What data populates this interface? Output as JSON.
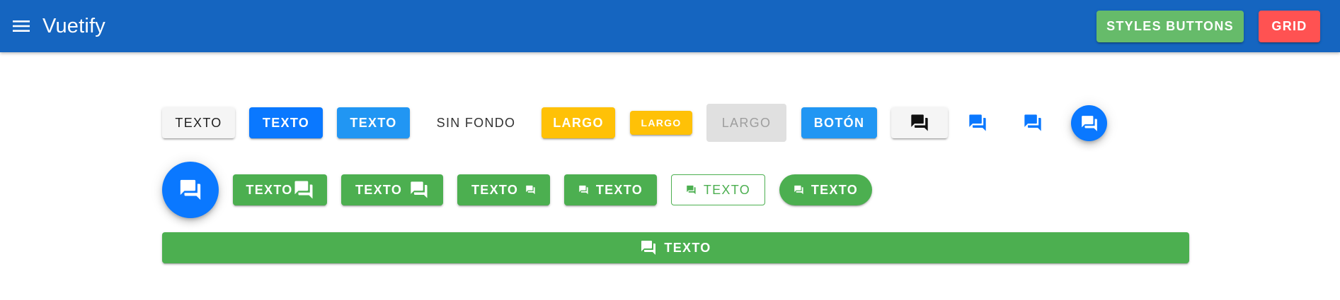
{
  "app_bar": {
    "title": "Vuetify",
    "menu_icon": "menu-icon",
    "actions": [
      {
        "label": "STYLES BUTTONS",
        "color": "#66bb6a"
      },
      {
        "label": "GRID",
        "color": "#ff5252"
      }
    ],
    "background": "#1565c0"
  },
  "row1": {
    "default_label": "TEXTO",
    "primary_label": "TEXTO",
    "info_label": "TEXTO",
    "text_label": "SIN FONDO",
    "large_label": "LARGO",
    "small_label": "LARGO",
    "disabled_label": "LARGO",
    "boton_label": "BOTÓN",
    "icon_name": "forum-icon"
  },
  "row2": {
    "labels": [
      "TEXTO",
      "TEXTO",
      "TEXTO",
      "TEXTO",
      "TEXTO",
      "TEXTO"
    ],
    "icon_name": "forum-icon"
  },
  "row3": {
    "block_label": "TEXTO",
    "icon_name": "forum-icon"
  },
  "colors": {
    "primary": "#0a78ff",
    "info": "#2196f3",
    "amber": "#ffc107",
    "success": "#4caf50",
    "disabled": "#e0e0e0"
  }
}
